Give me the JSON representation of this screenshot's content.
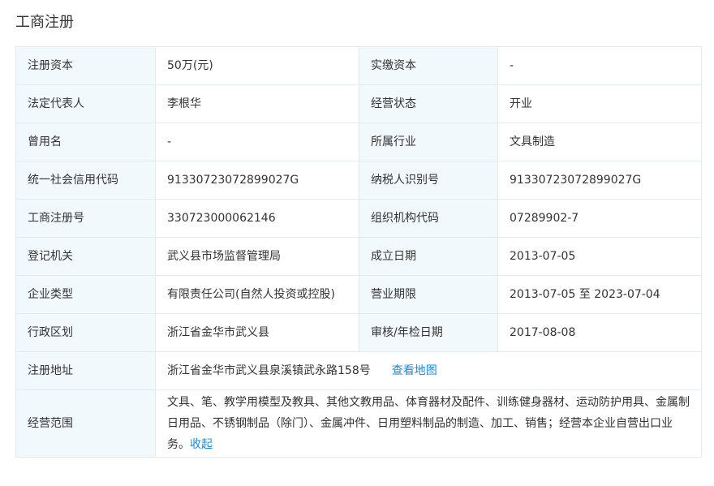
{
  "section_title": "工商注册",
  "rows": [
    {
      "l1": "注册资本",
      "v1": "50万(元)",
      "l2": "实缴资本",
      "v2": "-"
    },
    {
      "l1": "法定代表人",
      "v1": "李根华",
      "l2": "经营状态",
      "v2": "开业"
    },
    {
      "l1": "曾用名",
      "v1": "-",
      "l2": "所属行业",
      "v2": "文具制造"
    },
    {
      "l1": "统一社会信用代码",
      "v1": "91330723072899027G",
      "l2": "纳税人识别号",
      "v2": "91330723072899027G"
    },
    {
      "l1": "工商注册号",
      "v1": "330723000062146",
      "l2": "组织机构代码",
      "v2": "07289902-7"
    },
    {
      "l1": "登记机关",
      "v1": "武义县市场监督管理局",
      "l2": "成立日期",
      "v2": "2013-07-05"
    },
    {
      "l1": "企业类型",
      "v1": "有限责任公司(自然人投资或控股)",
      "l2": "营业期限",
      "v2": "2013-07-05 至 2023-07-04"
    },
    {
      "l1": "行政区划",
      "v1": "浙江省金华市武义县",
      "l2": "审核/年检日期",
      "v2": "2017-08-08"
    }
  ],
  "address": {
    "label": "注册地址",
    "value": "浙江省金华市武义县泉溪镇武永路158号",
    "map_link": "查看地图"
  },
  "scope": {
    "label": "经营范围",
    "value": "文具、笔、教学用模型及教具、其他文教用品、体育器材及配件、训练健身器材、运动防护用具、金属制日用品、不锈钢制品（除门）、金属冲件、日用塑料制品的制造、加工、销售；经营本企业自营出口业务。",
    "collapse_link": "收起"
  },
  "colors": {
    "label_bg": "#f2f9fc",
    "border": "#e4eaf2",
    "link": "#128bed",
    "text": "#333333"
  }
}
